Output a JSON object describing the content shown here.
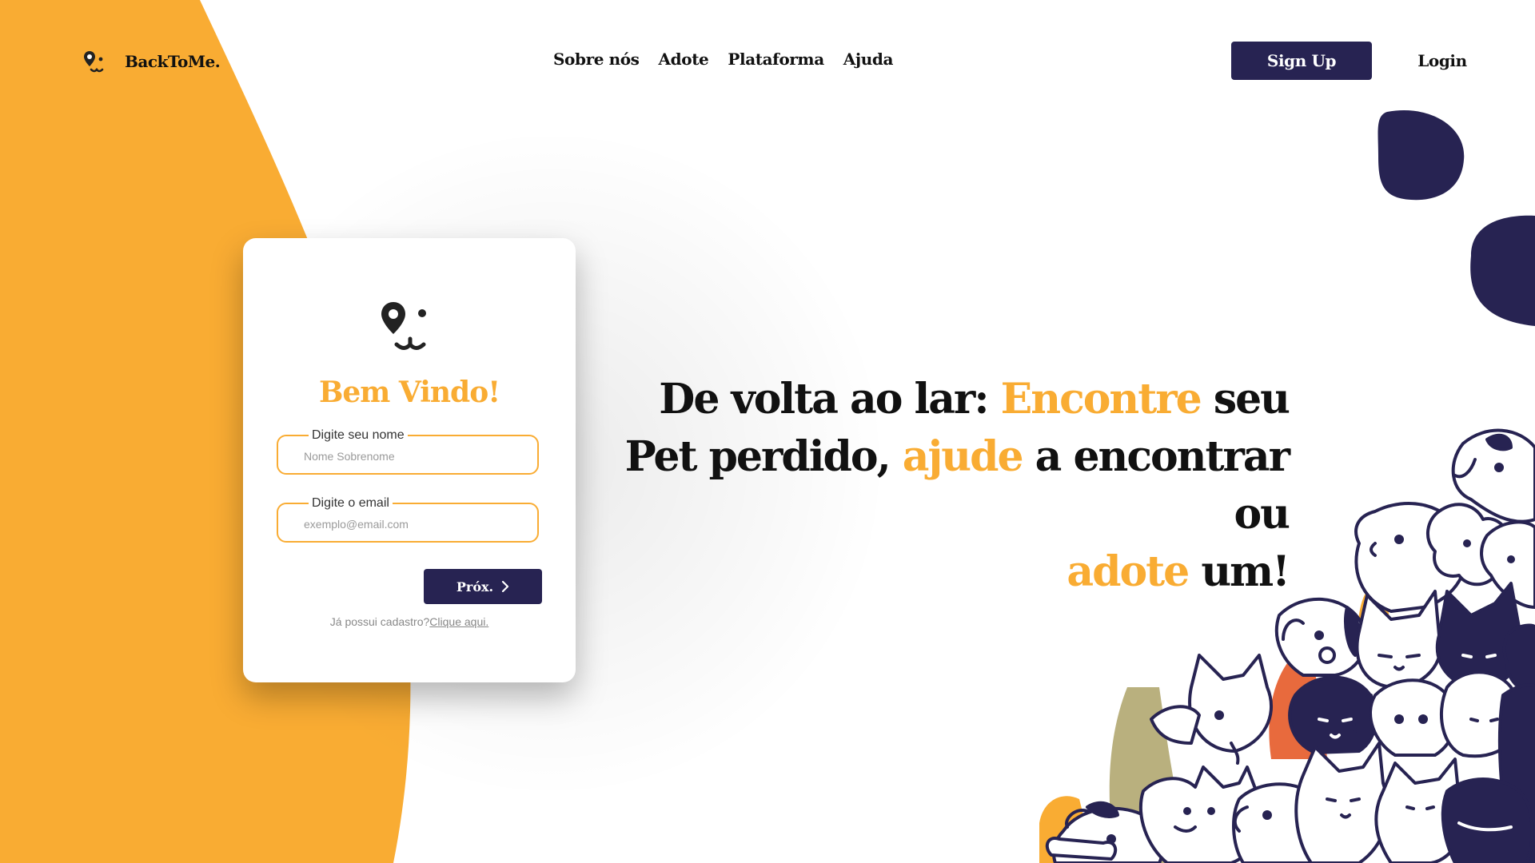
{
  "colors": {
    "accent": "#f9ac33",
    "navy": "#272352",
    "text": "#111111"
  },
  "header": {
    "brand_name": "BackToMe.",
    "nav": [
      "Sobre nós",
      "Adote",
      "Plataforma",
      "Ajuda"
    ],
    "signup_label": "Sign Up",
    "login_label": "Login"
  },
  "card": {
    "title": "Bem Vindo!",
    "name_label": "Digite seu nome",
    "name_placeholder": "Nome Sobrenome",
    "email_label": "Digite o email",
    "email_placeholder": "exemplo@email.com",
    "next_label": "Próx.",
    "signin_text": "Já possui cadastro?",
    "signin_link": "Clique aqui."
  },
  "headline": {
    "p1": "De volta ao lar: ",
    "h1": "Encontre",
    "p2": " seu Pet perdido, ",
    "h2": "ajude",
    "p3": " a encontrar ou ",
    "h3": "adote",
    "p4": " um!"
  },
  "icons": [
    "pin-dog-logo-icon",
    "chevron-right-icon",
    "dog-crowd-illustration"
  ]
}
